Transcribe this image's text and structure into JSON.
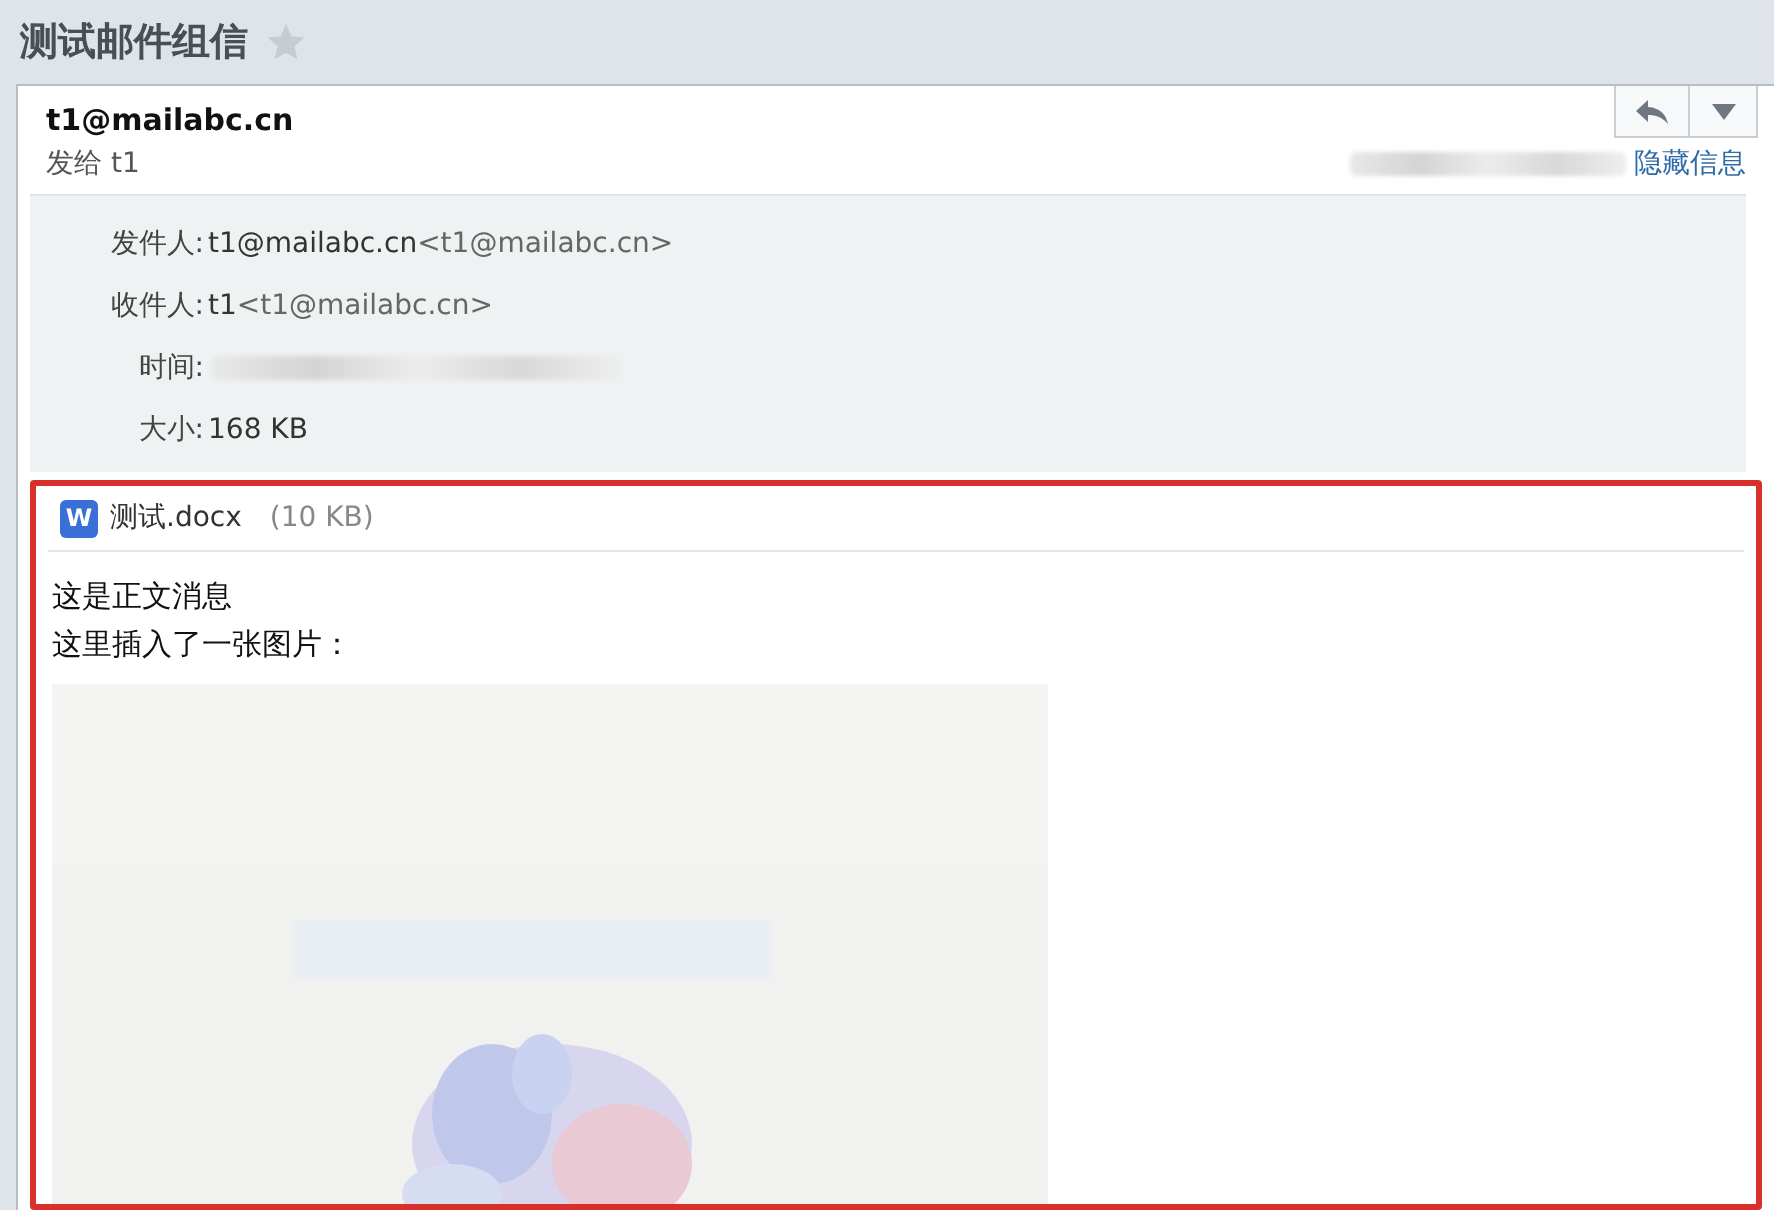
{
  "subject": {
    "title": "测试邮件组信",
    "starred": false
  },
  "header": {
    "sender": "t1@mailabc.cn",
    "sent_to": "发给 t1",
    "toggle_link": "隐藏信息"
  },
  "details": [
    {
      "label": "发件人:",
      "name": "t1@mailabc.cn",
      "address": "<t1@mailabc.cn>",
      "redacted": false
    },
    {
      "label": "收件人:",
      "name": "t1",
      "address": "<t1@mailabc.cn>",
      "redacted": false
    },
    {
      "label": "时间:",
      "redacted": true
    },
    {
      "label": "大小:",
      "name": "168 KB",
      "redacted": false
    }
  ],
  "attachment": {
    "icon_letter": "W",
    "name": "测试.docx",
    "size": "(10 KB)"
  },
  "body": {
    "lines": [
      "这是正文消息",
      "这里插入了一张图片："
    ]
  }
}
